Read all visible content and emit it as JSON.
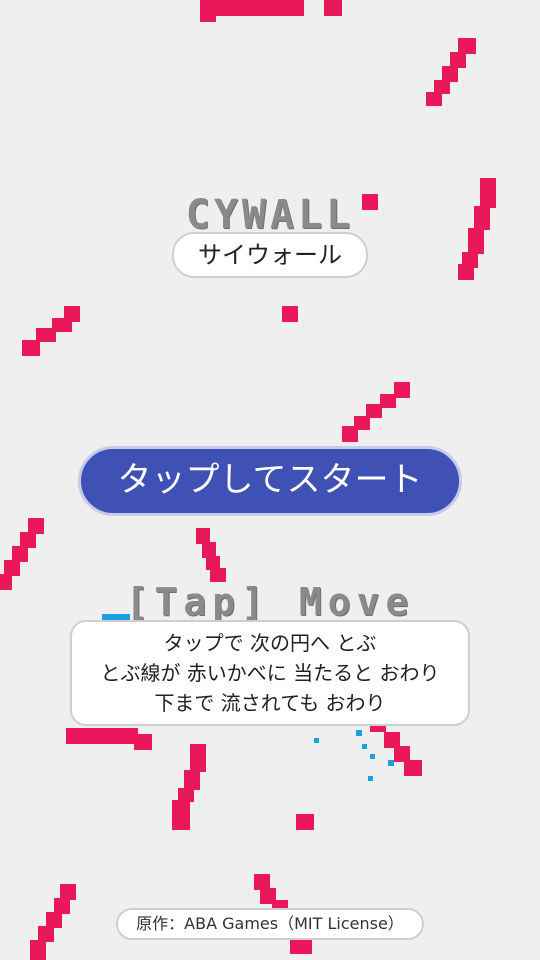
{
  "title": "CYWALL",
  "subtitle": "サイウォール",
  "start_button": "タップしてスタート",
  "controls": "[Tap] Move",
  "instructions": [
    "タップで 次の円へ とぶ",
    "とぶ線が 赤いかべに 当たると おわり",
    "下まで 流されても おわり"
  ],
  "credit": "原作：ABA Games（MIT License）",
  "colors": {
    "background": "#efefef",
    "wall": "#e8185a",
    "button": "#3f51b5",
    "spark": "#1aa0e0"
  }
}
